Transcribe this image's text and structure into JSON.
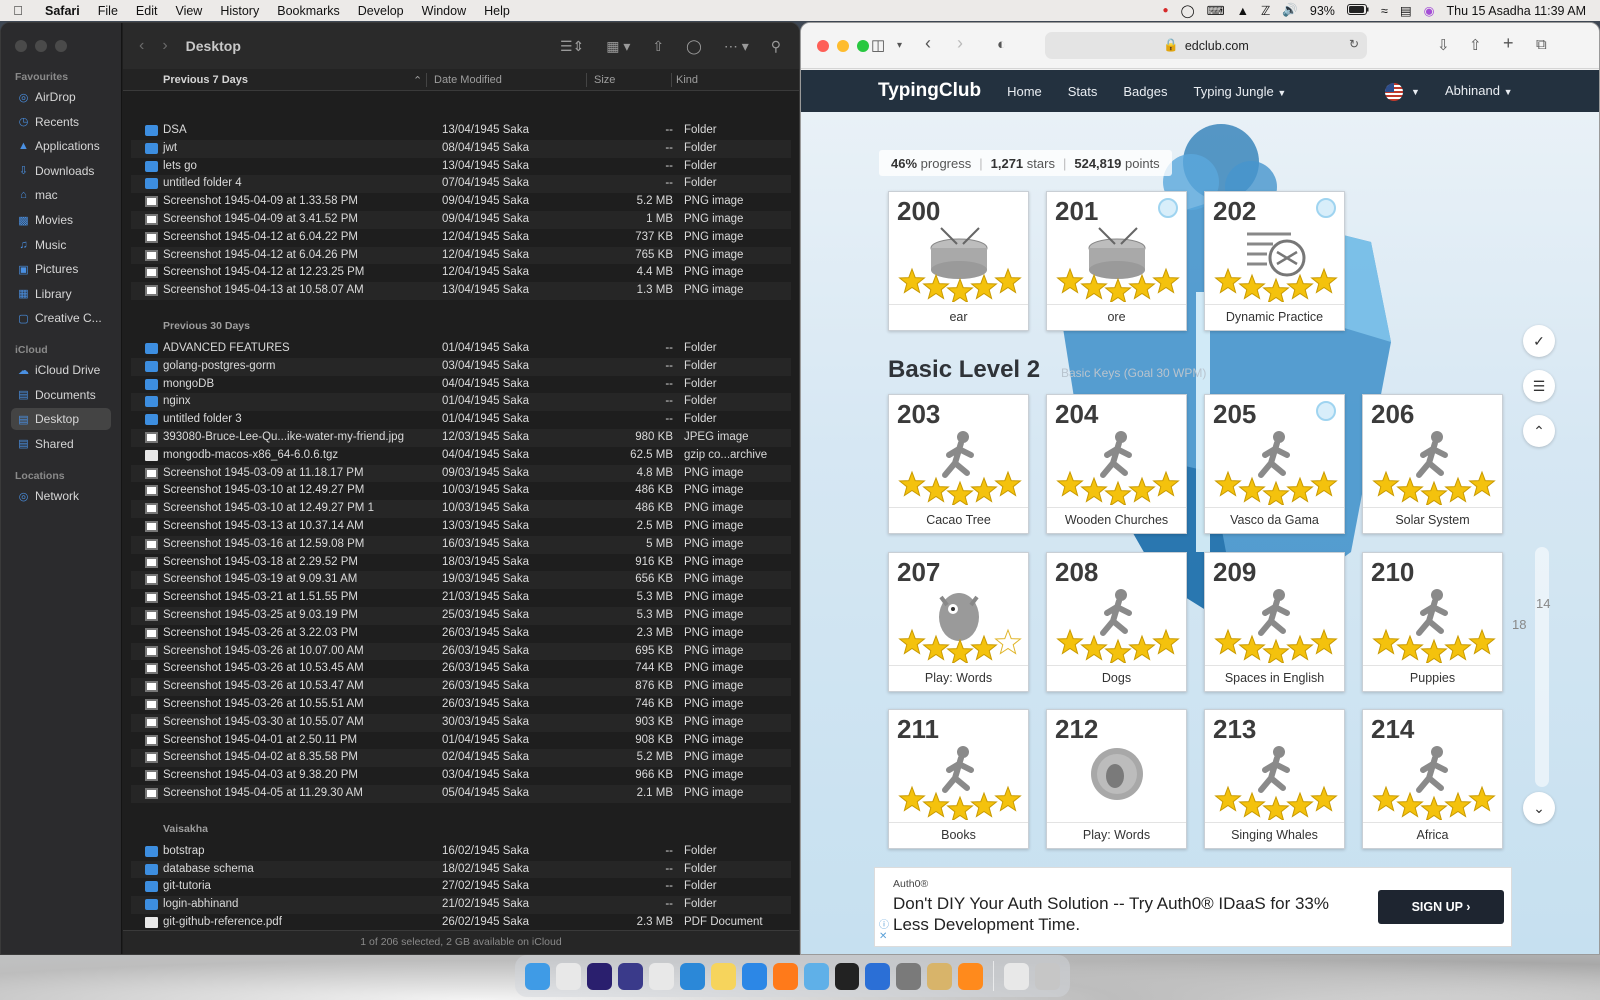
{
  "menubar": {
    "app": "Safari",
    "items": [
      "File",
      "Edit",
      "View",
      "History",
      "Bookmarks",
      "Develop",
      "Window",
      "Help"
    ],
    "battery": "93%",
    "datetime": "Thu 15 Asadha  11:39 AM"
  },
  "finder": {
    "title": "Desktop",
    "sidebar": {
      "favourites_label": "Favourites",
      "favourites": [
        "AirDrop",
        "Recents",
        "Applications",
        "Downloads",
        "mac",
        "Movies",
        "Music",
        "Pictures",
        "Library",
        "Creative C..."
      ],
      "icloud_label": "iCloud",
      "icloud": [
        "iCloud Drive",
        "Documents",
        "Desktop",
        "Shared"
      ],
      "locations_label": "Locations",
      "locations": [
        "Network"
      ]
    },
    "columns": {
      "name": "Previous 7 Days",
      "date": "Date Modified",
      "size": "Size",
      "kind": "Kind"
    },
    "groups": [
      {
        "label": "",
        "rows": [
          {
            "icon": "folder",
            "name": "DSA",
            "date": "13/04/1945 Saka",
            "size": "--",
            "kind": "Folder"
          },
          {
            "icon": "folder",
            "name": "jwt",
            "date": "08/04/1945 Saka",
            "size": "--",
            "kind": "Folder"
          },
          {
            "icon": "folder",
            "name": "lets go",
            "date": "13/04/1945 Saka",
            "size": "--",
            "kind": "Folder"
          },
          {
            "icon": "folder",
            "name": "untitled folder 4",
            "date": "07/04/1945 Saka",
            "size": "--",
            "kind": "Folder"
          },
          {
            "icon": "img",
            "name": "Screenshot 1945-04-09 at 1.33.58 PM",
            "date": "09/04/1945 Saka",
            "size": "5.2 MB",
            "kind": "PNG image"
          },
          {
            "icon": "img",
            "name": "Screenshot 1945-04-09 at 3.41.52 PM",
            "date": "09/04/1945 Saka",
            "size": "1 MB",
            "kind": "PNG image"
          },
          {
            "icon": "img",
            "name": "Screenshot 1945-04-12 at 6.04.22 PM",
            "date": "12/04/1945 Saka",
            "size": "737 KB",
            "kind": "PNG image"
          },
          {
            "icon": "img",
            "name": "Screenshot 1945-04-12 at 6.04.26 PM",
            "date": "12/04/1945 Saka",
            "size": "765 KB",
            "kind": "PNG image"
          },
          {
            "icon": "img",
            "name": "Screenshot 1945-04-12 at 12.23.25 PM",
            "date": "12/04/1945 Saka",
            "size": "4.4 MB",
            "kind": "PNG image"
          },
          {
            "icon": "img",
            "name": "Screenshot 1945-04-13 at 10.58.07 AM",
            "date": "13/04/1945 Saka",
            "size": "1.3 MB",
            "kind": "PNG image"
          }
        ]
      },
      {
        "label": "Previous 30 Days",
        "rows": [
          {
            "icon": "folder",
            "name": "ADVANCED FEATURES",
            "date": "01/04/1945 Saka",
            "size": "--",
            "kind": "Folder"
          },
          {
            "icon": "folder",
            "name": "golang-postgres-gorm",
            "date": "03/04/1945 Saka",
            "size": "--",
            "kind": "Folder"
          },
          {
            "icon": "folder",
            "name": "mongoDB",
            "date": "04/04/1945 Saka",
            "size": "--",
            "kind": "Folder"
          },
          {
            "icon": "folder",
            "name": "nginx",
            "date": "01/04/1945 Saka",
            "size": "--",
            "kind": "Folder"
          },
          {
            "icon": "folder",
            "name": "untitled folder 3",
            "date": "01/04/1945 Saka",
            "size": "--",
            "kind": "Folder"
          },
          {
            "icon": "img",
            "name": "393080-Bruce-Lee-Qu...ike-water-my-friend.jpg",
            "date": "12/03/1945 Saka",
            "size": "980 KB",
            "kind": "JPEG image"
          },
          {
            "icon": "doc",
            "name": "mongodb-macos-x86_64-6.0.6.tgz",
            "date": "04/04/1945 Saka",
            "size": "62.5 MB",
            "kind": "gzip co...archive"
          },
          {
            "icon": "img",
            "name": "Screenshot 1945-03-09 at 11.18.17 PM",
            "date": "09/03/1945 Saka",
            "size": "4.8 MB",
            "kind": "PNG image"
          },
          {
            "icon": "img",
            "name": "Screenshot 1945-03-10 at 12.49.27 PM",
            "date": "10/03/1945 Saka",
            "size": "486 KB",
            "kind": "PNG image"
          },
          {
            "icon": "img",
            "name": "Screenshot 1945-03-10 at 12.49.27 PM 1",
            "date": "10/03/1945 Saka",
            "size": "486 KB",
            "kind": "PNG image"
          },
          {
            "icon": "img",
            "name": "Screenshot 1945-03-13 at 10.37.14 AM",
            "date": "13/03/1945 Saka",
            "size": "2.5 MB",
            "kind": "PNG image"
          },
          {
            "icon": "img",
            "name": "Screenshot 1945-03-16 at 12.59.08 PM",
            "date": "16/03/1945 Saka",
            "size": "5 MB",
            "kind": "PNG image"
          },
          {
            "icon": "img",
            "name": "Screenshot 1945-03-18 at 2.29.52 PM",
            "date": "18/03/1945 Saka",
            "size": "916 KB",
            "kind": "PNG image"
          },
          {
            "icon": "img",
            "name": "Screenshot 1945-03-19 at 9.09.31 AM",
            "date": "19/03/1945 Saka",
            "size": "656 KB",
            "kind": "PNG image"
          },
          {
            "icon": "img",
            "name": "Screenshot 1945-03-21 at 1.51.55 PM",
            "date": "21/03/1945 Saka",
            "size": "5.3 MB",
            "kind": "PNG image"
          },
          {
            "icon": "img",
            "name": "Screenshot 1945-03-25 at 9.03.19 PM",
            "date": "25/03/1945 Saka",
            "size": "5.3 MB",
            "kind": "PNG image"
          },
          {
            "icon": "img",
            "name": "Screenshot 1945-03-26 at 3.22.03 PM",
            "date": "26/03/1945 Saka",
            "size": "2.3 MB",
            "kind": "PNG image"
          },
          {
            "icon": "img",
            "name": "Screenshot 1945-03-26 at 10.07.00 AM",
            "date": "26/03/1945 Saka",
            "size": "695 KB",
            "kind": "PNG image"
          },
          {
            "icon": "img",
            "name": "Screenshot 1945-03-26 at 10.53.45 AM",
            "date": "26/03/1945 Saka",
            "size": "744 KB",
            "kind": "PNG image"
          },
          {
            "icon": "img",
            "name": "Screenshot 1945-03-26 at 10.53.47 AM",
            "date": "26/03/1945 Saka",
            "size": "876 KB",
            "kind": "PNG image"
          },
          {
            "icon": "img",
            "name": "Screenshot 1945-03-26 at 10.55.51 AM",
            "date": "26/03/1945 Saka",
            "size": "746 KB",
            "kind": "PNG image"
          },
          {
            "icon": "img",
            "name": "Screenshot 1945-03-30 at 10.55.07 AM",
            "date": "30/03/1945 Saka",
            "size": "903 KB",
            "kind": "PNG image"
          },
          {
            "icon": "img",
            "name": "Screenshot 1945-04-01 at 2.50.11 PM",
            "date": "01/04/1945 Saka",
            "size": "908 KB",
            "kind": "PNG image"
          },
          {
            "icon": "img",
            "name": "Screenshot 1945-04-02 at 8.35.58 PM",
            "date": "02/04/1945 Saka",
            "size": "5.2 MB",
            "kind": "PNG image"
          },
          {
            "icon": "img",
            "name": "Screenshot 1945-04-03 at 9.38.20 PM",
            "date": "03/04/1945 Saka",
            "size": "966 KB",
            "kind": "PNG image"
          },
          {
            "icon": "img",
            "name": "Screenshot 1945-04-05 at 11.29.30 AM",
            "date": "05/04/1945 Saka",
            "size": "2.1 MB",
            "kind": "PNG image"
          }
        ]
      },
      {
        "label": "Vaisakha",
        "rows": [
          {
            "icon": "folder",
            "name": "botstrap",
            "date": "16/02/1945 Saka",
            "size": "--",
            "kind": "Folder"
          },
          {
            "icon": "folder",
            "name": "database schema",
            "date": "18/02/1945 Saka",
            "size": "--",
            "kind": "Folder"
          },
          {
            "icon": "folder",
            "name": "git-tutoria",
            "date": "27/02/1945 Saka",
            "size": "--",
            "kind": "Folder"
          },
          {
            "icon": "folder",
            "name": "login-abhinand",
            "date": "21/02/1945 Saka",
            "size": "--",
            "kind": "Folder"
          },
          {
            "icon": "doc",
            "name": "git-github-reference.pdf",
            "date": "26/02/1945 Saka",
            "size": "2.3 MB",
            "kind": "PDF Document"
          }
        ]
      }
    ],
    "status": "1 of 206 selected, 2 GB available on iCloud"
  },
  "safari": {
    "url": "edclub.com",
    "nav": {
      "logo": "TypingClub",
      "links": [
        "Home",
        "Stats",
        "Badges",
        "Typing Jungle"
      ],
      "user": "Abhinand"
    },
    "progress": {
      "percent": "46%",
      "percent_label": "progress",
      "stars": "1,271",
      "stars_label": "stars",
      "points": "524,819",
      "points_label": "points"
    },
    "level_title": "Basic Level 2",
    "level_subtitle": "Basic Keys (Goal 30 WPM)",
    "lessons": [
      {
        "num": "200",
        "label": "ear",
        "art": "drum",
        "stars": 5,
        "badge": false
      },
      {
        "num": "201",
        "label": "ore",
        "art": "drum",
        "stars": 5,
        "badge": true
      },
      {
        "num": "202",
        "label": "Dynamic Practice",
        "art": "shuffle",
        "stars": 5,
        "badge": true
      },
      {
        "num": "203",
        "label": "Cacao Tree",
        "art": "runner",
        "stars": 5,
        "badge": false
      },
      {
        "num": "204",
        "label": "Wooden Churches",
        "art": "runner",
        "stars": 5,
        "badge": false
      },
      {
        "num": "205",
        "label": "Vasco da Gama",
        "art": "runner",
        "stars": 5,
        "badge": true
      },
      {
        "num": "206",
        "label": "Solar System",
        "art": "runner",
        "stars": 5,
        "badge": false
      },
      {
        "num": "207",
        "label": "Play: Words",
        "art": "monster",
        "stars": 4,
        "badge": false
      },
      {
        "num": "208",
        "label": "Dogs",
        "art": "runner",
        "stars": 5,
        "badge": false
      },
      {
        "num": "209",
        "label": "Spaces in English",
        "art": "runner",
        "stars": 5,
        "badge": false
      },
      {
        "num": "210",
        "label": "Puppies",
        "art": "runner",
        "stars": 5,
        "badge": false
      },
      {
        "num": "211",
        "label": "Books",
        "art": "runner",
        "stars": 5,
        "badge": false
      },
      {
        "num": "212",
        "label": "Play: Words",
        "art": "game",
        "stars": 0,
        "badge": false
      },
      {
        "num": "213",
        "label": "Singing Whales",
        "art": "runner",
        "stars": 5,
        "badge": false
      },
      {
        "num": "214",
        "label": "Africa",
        "art": "runner",
        "stars": 5,
        "badge": false
      }
    ],
    "scroll_numbers": [
      "14",
      "18"
    ],
    "ad": {
      "brand": "Auth0®",
      "copy": "Don't DIY Your Auth Solution -- Try Auth0® IDaaS for 33% Less Development Time.",
      "cta": "SIGN UP"
    }
  },
  "colors": {
    "tc_nav": "#23313f",
    "star": "#f4c20d",
    "folder": "#3d8ee0"
  },
  "dock_apps": [
    "finder-icon",
    "launchpad-icon",
    "premiere-icon",
    "eclipse-icon",
    "chrome-icon",
    "vscode-icon",
    "notes-icon",
    "safari-icon",
    "firefox-icon",
    "preview-icon",
    "davinci-icon",
    "mail-icon",
    "settings-icon",
    "archive-icon",
    "books-icon",
    "files-icon",
    "trash-icon"
  ]
}
